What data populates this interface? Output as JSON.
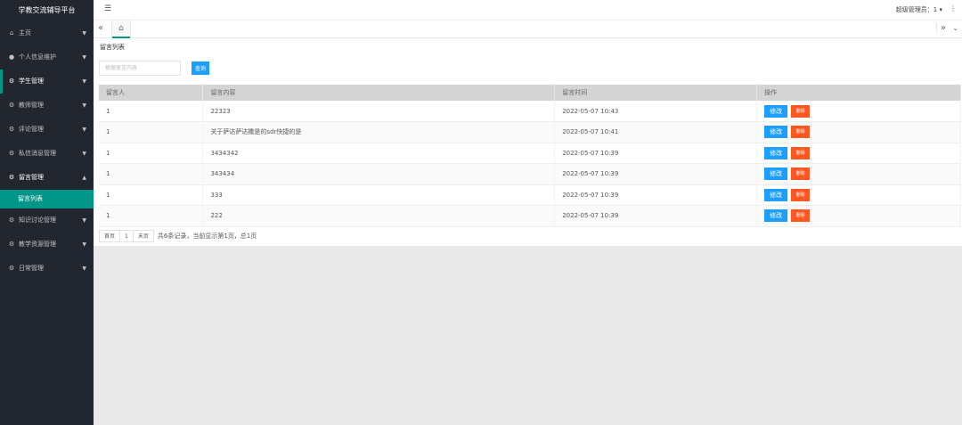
{
  "app": {
    "title": "学教交流辅导平台"
  },
  "sidebar": {
    "items": [
      {
        "icon": "home-icon",
        "icon_glyph": "⌂",
        "label": "主页"
      },
      {
        "icon": "user-icon",
        "icon_glyph": "●",
        "label": "个人信息维护"
      },
      {
        "icon": "gear-icon",
        "icon_glyph": "⚙",
        "label": "学生管理"
      },
      {
        "icon": "gear-icon",
        "icon_glyph": "⚙",
        "label": "教师管理"
      },
      {
        "icon": "gear-icon",
        "icon_glyph": "⚙",
        "label": "评论管理"
      },
      {
        "icon": "gear-icon",
        "icon_glyph": "⚙",
        "label": "私信消息管理"
      },
      {
        "icon": "gear-icon",
        "icon_glyph": "⚙",
        "label": "留言管理",
        "expanded": true
      },
      {
        "icon": "gear-icon",
        "icon_glyph": "⚙",
        "label": "知识讨论管理"
      },
      {
        "icon": "gear-icon",
        "icon_glyph": "⚙",
        "label": "教学资源管理"
      },
      {
        "icon": "gear-icon",
        "icon_glyph": "⚙",
        "label": "日常管理"
      }
    ],
    "active_sub": "留言列表"
  },
  "header": {
    "menu_glyph": "☰",
    "user": "超级管理员：1 ▾",
    "more_glyph": "⋮"
  },
  "tabs": {
    "prev_glyph": "«",
    "home_glyph": "⌂",
    "next_glyph": "»",
    "down_glyph": "⌄"
  },
  "main": {
    "breadcrumb": "留言列表",
    "search": {
      "placeholder": "根据留言内容",
      "button": "查询"
    },
    "table": {
      "headers": [
        "留言人",
        "留言内容",
        "留言时间",
        "操作"
      ],
      "rows": [
        {
          "author": "1",
          "content": "22323",
          "time": "2022-05-07 10:43"
        },
        {
          "author": "1",
          "content": "关于萨达萨达撒是的sdr快捷的是",
          "time": "2022-05-07 10:41"
        },
        {
          "author": "1",
          "content": "3434342",
          "time": "2022-05-07 10:39"
        },
        {
          "author": "1",
          "content": "343434",
          "time": "2022-05-07 10:39"
        },
        {
          "author": "1",
          "content": "333",
          "time": "2022-05-07 10:39"
        },
        {
          "author": "1",
          "content": "222",
          "time": "2022-05-07 10:39"
        }
      ],
      "edit_label": "修改",
      "delete_label": "删除"
    },
    "pager": {
      "first": "首页",
      "page": "1",
      "last": "末页",
      "info": "共6条记录，当前显示第1页，总1页"
    }
  },
  "colors": {
    "sidebar_bg": "#22262e",
    "accent": "#009688",
    "primary_btn": "#1e9fff",
    "danger_btn": "#ff5722"
  }
}
